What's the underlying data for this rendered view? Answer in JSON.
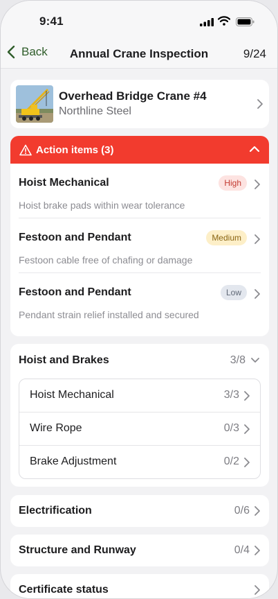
{
  "status_bar": {
    "time": "9:41"
  },
  "nav": {
    "back_label": "Back",
    "title": "Annual Crane Inspection",
    "progress": "9/24"
  },
  "asset": {
    "name": "Overhead Bridge Crane #4",
    "owner": "Northline Steel",
    "thumbnail": "crane-photo"
  },
  "action_items": {
    "header": "Action items (3)",
    "items": [
      {
        "title": "Hoist Mechanical",
        "priority": "High",
        "description": "Hoist brake pads within wear tolerance"
      },
      {
        "title": "Festoon and Pendant",
        "priority": "Medium",
        "description": "Festoon cable free of chafing or damage"
      },
      {
        "title": "Festoon and Pendant",
        "priority": "Low",
        "description": "Pendant strain relief installed and secured"
      }
    ]
  },
  "sections": {
    "hoist": {
      "title": "Hoist and Brakes",
      "count": "3/8",
      "subsections": [
        {
          "label": "Hoist Mechanical",
          "count": "3/3"
        },
        {
          "label": "Wire Rope",
          "count": "0/3"
        },
        {
          "label": "Brake Adjustment",
          "count": "0/2"
        }
      ]
    },
    "electrification": {
      "title": "Electrification",
      "count": "0/6"
    },
    "structure": {
      "title": "Structure and Runway",
      "count": "0/4"
    },
    "certificate": {
      "title": "Certificate status"
    }
  },
  "colors": {
    "accent": "#2f5d2a",
    "alert": "#f23b2e",
    "high_badge": "#fde3e1",
    "medium_badge": "#fdefc8",
    "low_badge": "#e3e7ee"
  }
}
